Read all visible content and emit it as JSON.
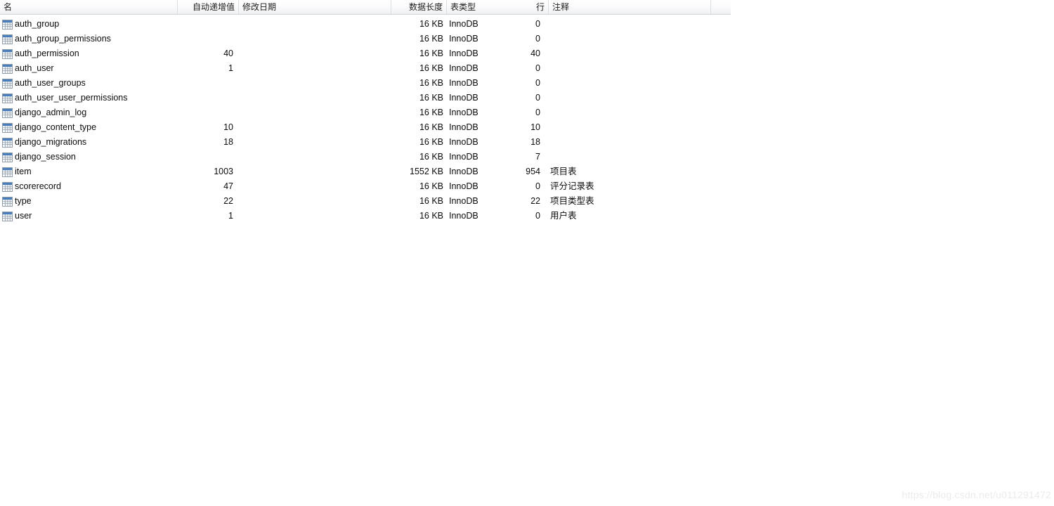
{
  "grid": {
    "columns": [
      {
        "key": "name",
        "label": "名",
        "align": "left"
      },
      {
        "key": "auto_inc",
        "label": "自动递增值",
        "align": "right"
      },
      {
        "key": "modified",
        "label": "修改日期",
        "align": "left"
      },
      {
        "key": "length",
        "label": "数据长度",
        "align": "right"
      },
      {
        "key": "engine",
        "label": "表类型",
        "align": "left"
      },
      {
        "key": "rows",
        "label": "行",
        "align": "right"
      },
      {
        "key": "comment",
        "label": "注释",
        "align": "left"
      }
    ],
    "rows": [
      {
        "name": "auth_group",
        "auto_inc": "",
        "modified": "",
        "length": "16 KB",
        "engine": "InnoDB",
        "rows": "0",
        "comment": ""
      },
      {
        "name": "auth_group_permissions",
        "auto_inc": "",
        "modified": "",
        "length": "16 KB",
        "engine": "InnoDB",
        "rows": "0",
        "comment": ""
      },
      {
        "name": "auth_permission",
        "auto_inc": "40",
        "modified": "",
        "length": "16 KB",
        "engine": "InnoDB",
        "rows": "40",
        "comment": ""
      },
      {
        "name": "auth_user",
        "auto_inc": "1",
        "modified": "",
        "length": "16 KB",
        "engine": "InnoDB",
        "rows": "0",
        "comment": ""
      },
      {
        "name": "auth_user_groups",
        "auto_inc": "",
        "modified": "",
        "length": "16 KB",
        "engine": "InnoDB",
        "rows": "0",
        "comment": ""
      },
      {
        "name": "auth_user_user_permissions",
        "auto_inc": "",
        "modified": "",
        "length": "16 KB",
        "engine": "InnoDB",
        "rows": "0",
        "comment": ""
      },
      {
        "name": "django_admin_log",
        "auto_inc": "",
        "modified": "",
        "length": "16 KB",
        "engine": "InnoDB",
        "rows": "0",
        "comment": ""
      },
      {
        "name": "django_content_type",
        "auto_inc": "10",
        "modified": "",
        "length": "16 KB",
        "engine": "InnoDB",
        "rows": "10",
        "comment": ""
      },
      {
        "name": "django_migrations",
        "auto_inc": "18",
        "modified": "",
        "length": "16 KB",
        "engine": "InnoDB",
        "rows": "18",
        "comment": ""
      },
      {
        "name": "django_session",
        "auto_inc": "",
        "modified": "",
        "length": "16 KB",
        "engine": "InnoDB",
        "rows": "7",
        "comment": ""
      },
      {
        "name": "item",
        "auto_inc": "1003",
        "modified": "",
        "length": "1552 KB",
        "engine": "InnoDB",
        "rows": "954",
        "comment": "项目表"
      },
      {
        "name": "scorerecord",
        "auto_inc": "47",
        "modified": "",
        "length": "16 KB",
        "engine": "InnoDB",
        "rows": "0",
        "comment": "评分记录表"
      },
      {
        "name": "type",
        "auto_inc": "22",
        "modified": "",
        "length": "16 KB",
        "engine": "InnoDB",
        "rows": "22",
        "comment": "项目类型表"
      },
      {
        "name": "user",
        "auto_inc": "1",
        "modified": "",
        "length": "16 KB",
        "engine": "InnoDB",
        "rows": "0",
        "comment": "用户表"
      }
    ],
    "row_icon": "table-icon"
  },
  "watermark": {
    "text": "https://blog.csdn.net/u011291472"
  },
  "colors": {
    "header_bg_top": "#ffffff",
    "header_bg_bottom": "#eaebed",
    "header_border": "#d6d7d9",
    "column_separator": "#dcdddf",
    "text": "#0a0a0a",
    "icon_accent": "#4a7ebb",
    "icon_grid": "#9aa7b4",
    "watermark": "#ebebeb"
  }
}
